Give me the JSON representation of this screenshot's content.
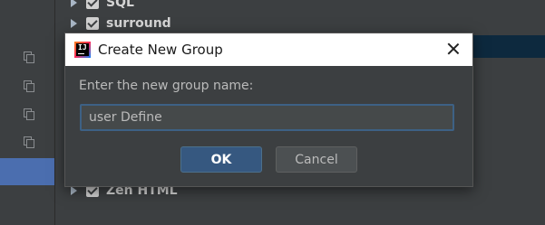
{
  "background": {
    "tree_items": [
      {
        "label": "SQL"
      },
      {
        "label": "surround"
      },
      {
        "label": "Zen HTML"
      }
    ]
  },
  "dialog": {
    "title": "Create New Group",
    "prompt": "Enter the new group name:",
    "input_value": "user Define",
    "ok_label": "OK",
    "cancel_label": "Cancel",
    "icons": {
      "app": "intellij-logo-icon",
      "close": "close-icon"
    }
  },
  "colors": {
    "ide_bg": "#3c3f41",
    "selection": "#4b6eaf",
    "ok_button": "#365880",
    "input_focus_border": "#3d6185"
  }
}
